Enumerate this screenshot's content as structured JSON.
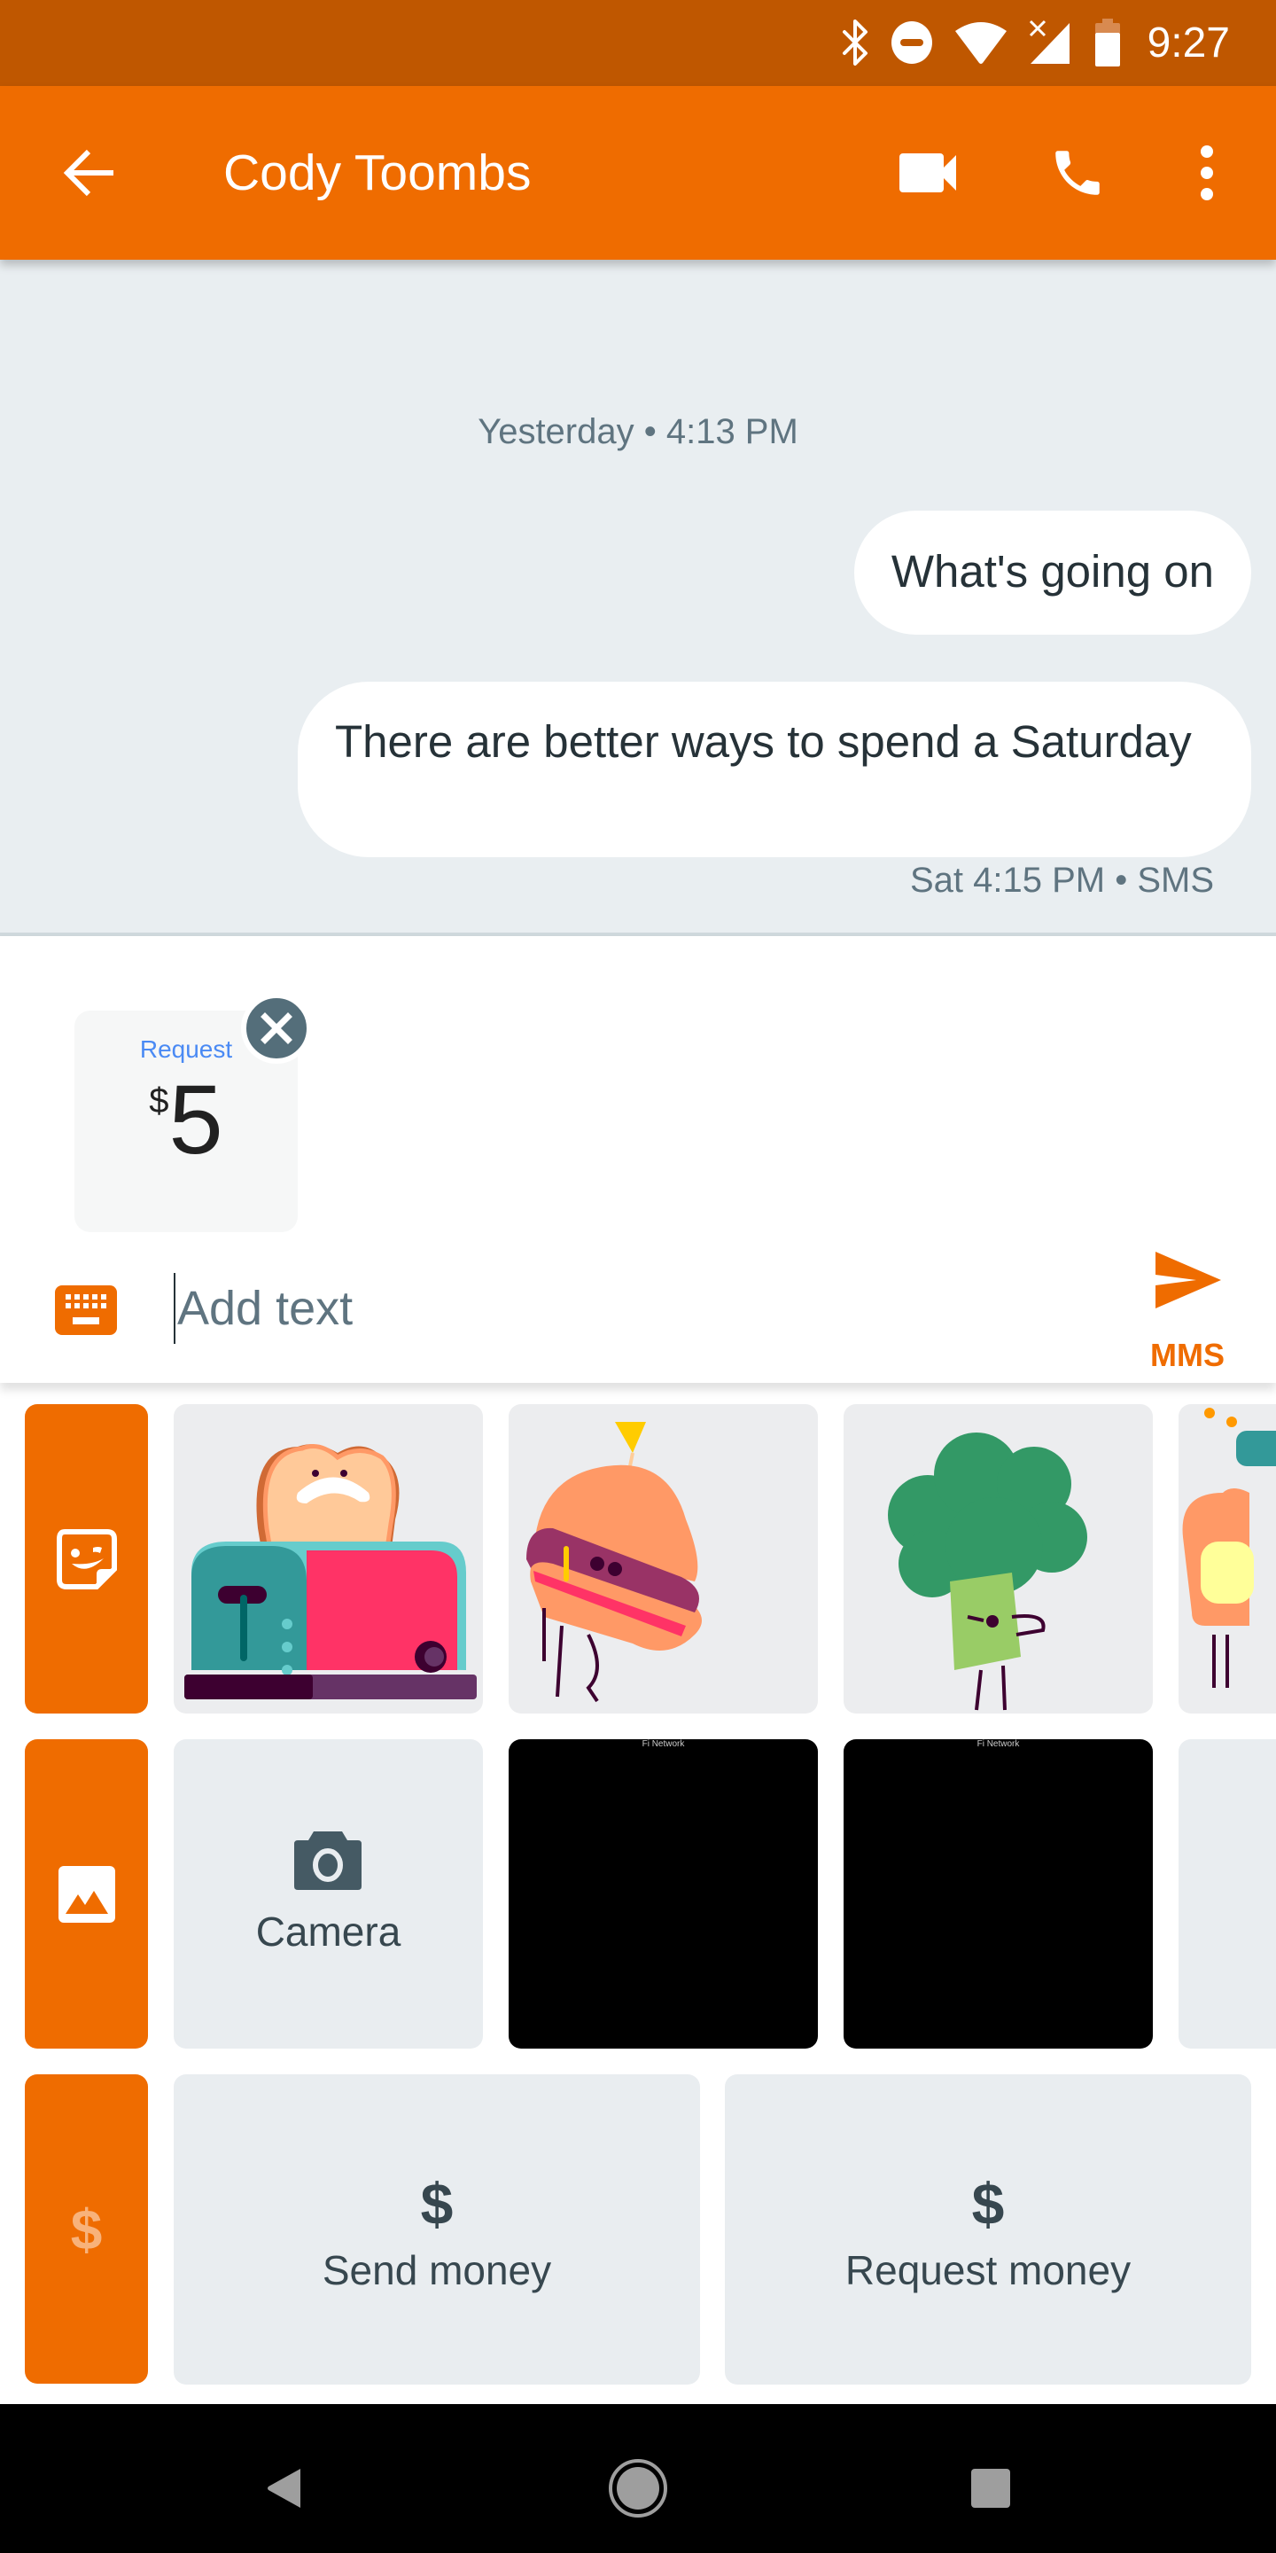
{
  "status_bar": {
    "time": "9:27",
    "icons": [
      "bluetooth-icon",
      "do-not-disturb-icon",
      "wifi-icon",
      "cell-signal-no-service-icon",
      "battery-icon"
    ]
  },
  "app_bar": {
    "title": "Cody Toombs",
    "back_icon": "arrow-back-icon",
    "actions": [
      "video-call-icon",
      "phone-call-icon",
      "more-vert-icon"
    ]
  },
  "conversation": {
    "timestamp": "Yesterday • 4:13 PM",
    "messages": [
      {
        "text": "What's going on",
        "direction": "outgoing"
      },
      {
        "text": "There are better ways to spend a Saturday",
        "direction": "outgoing"
      }
    ],
    "last_meta": "Sat 4:15 PM • SMS"
  },
  "compose": {
    "attachment": {
      "label": "Request",
      "currency": "$",
      "amount": "5"
    },
    "input_value": "",
    "placeholder": "Add text",
    "send_label": "MMS",
    "colors": {
      "accent": "#ef6c00",
      "request_blue": "#4a8af4",
      "close_bg": "#546e7a"
    }
  },
  "tray": {
    "sections": [
      {
        "icon": "sticker-icon",
        "items": [
          "toaster-sticker",
          "burger-sticker",
          "broccoli-sticker",
          "toast-sticker"
        ]
      },
      {
        "icon": "gallery-icon",
        "items": [
          "camera-tile",
          "photo-thumbnail",
          "photo-thumbnail",
          "photo-thumbnail"
        ]
      },
      {
        "icon": "money-icon",
        "items": [
          "send-money",
          "request-money"
        ]
      }
    ],
    "camera_label": "Camera",
    "thumbnail_caption": "Fi Network",
    "money_symbol": "$",
    "send_money_label": "Send money",
    "request_money_label": "Request money"
  },
  "nav_bar": {
    "buttons": [
      "back",
      "home",
      "recents"
    ]
  }
}
